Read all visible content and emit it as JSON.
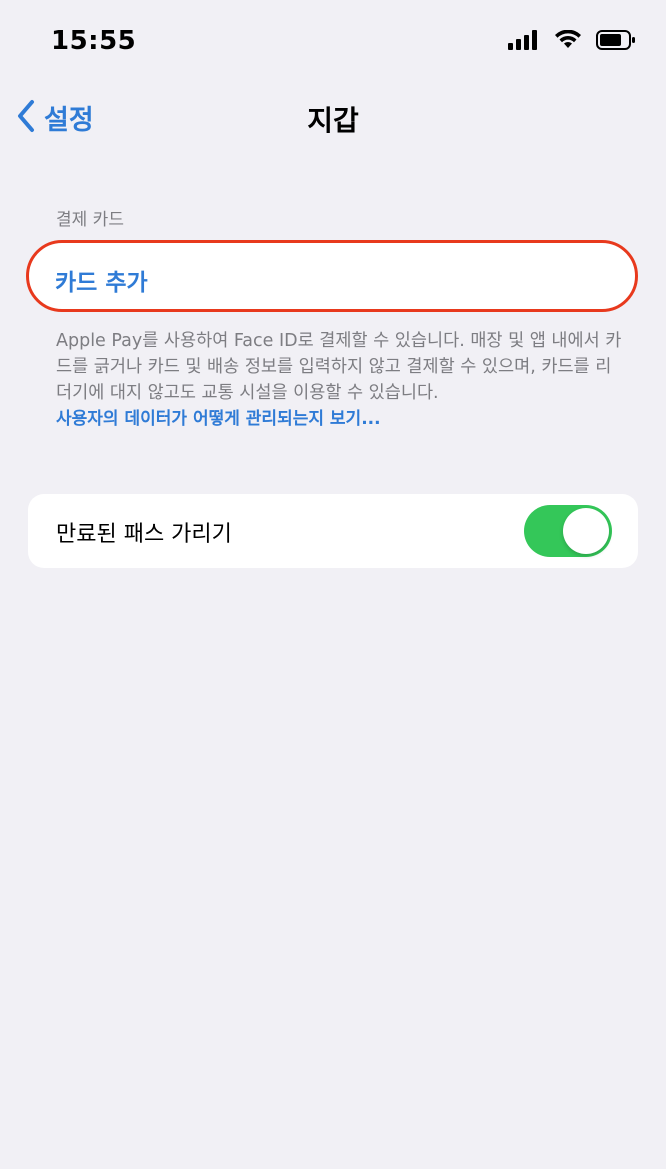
{
  "status_bar": {
    "time": "15:55",
    "icons": [
      "cellular-signal-icon",
      "wifi-icon",
      "battery-icon"
    ]
  },
  "nav": {
    "back_label": "설정",
    "title": "지갑"
  },
  "payment_section": {
    "header": "결제 카드",
    "add_card_label": "카드 추가",
    "footer_text": "Apple Pay를 사용하여 Face ID로 결제할 수 있습니다. 매장 및 앱 내에서 카드를 긁거나 카드 및 배송 정보를 입력하지 않고 결제할 수 있으며, 카드를 리더기에 대지 않고도 교통 시설을 이용할 수 있습니다.",
    "footer_link": "사용자의 데이터가 어떻게 관리되는지 보기..."
  },
  "expired_passes": {
    "label": "만료된 패스 가리기",
    "enabled": true
  },
  "colors": {
    "accent": "#2f7bd6",
    "background": "#f1f0f5",
    "toggle_on": "#34c759",
    "highlight": "#e8391d"
  }
}
